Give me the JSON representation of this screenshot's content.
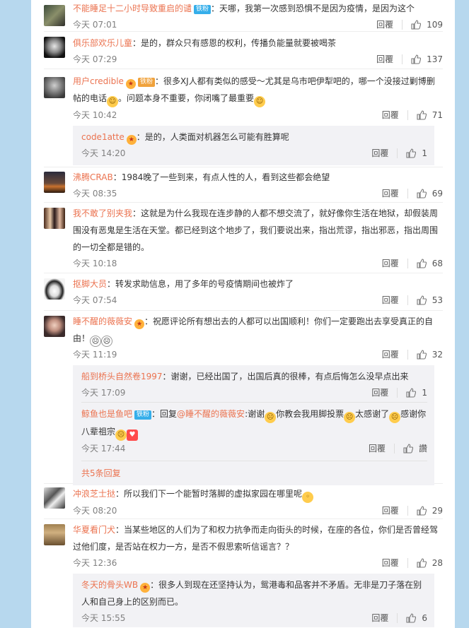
{
  "comments": [
    {
      "name": "不能睡足十二小时导致重启的谴",
      "badge": "铁粉",
      "text": "：天哪，我第一次感到恐惧不是因为疫情，是因为这个",
      "time": "今天 07:01",
      "reply": "回覆",
      "likes": "109"
    },
    {
      "name": "俱乐部欢乐儿童",
      "text": "：是的，群众只有感恩的权利，传播负能量就要被喝茶",
      "time": "今天 07:29",
      "reply": "回覆",
      "likes": "137"
    },
    {
      "name": "用户credible",
      "badge": "铁粉",
      "text_a": "：很多XJ人都有类似的感受～尤其是乌市吧伊犁吧的，哪一个没接过剿博删帖的电话",
      "text_b": "。问题本身不重要，你闭嘴了最重要",
      "time": "今天 10:42",
      "reply": "回覆",
      "likes": "71",
      "sub": [
        {
          "name": "code1atte",
          "text": "：是的，人类面对机器怎么可能有胜算呢",
          "time": "今天 14:20",
          "reply": "回覆",
          "likes": "1"
        }
      ]
    },
    {
      "name": "沸腾CRAB",
      "text": "：1984晚了一些到来，有点人性的人，看到这些都会绝望",
      "time": "今天 08:35",
      "reply": "回覆",
      "likes": "69"
    },
    {
      "name": "我不敢了别夹我",
      "text": "：这就是为什么我现在连步静的人都不想交流了，就好像你生活在地狱，却假装周围没有恶鬼是生活在天堂。都已经到这个地步了，我们要说出来，指出荒谬，指出邪恶，指出周围的一切全都是错的。",
      "time": "今天 10:18",
      "reply": "回覆",
      "likes": "68"
    },
    {
      "name": "抠脚大员",
      "text": "：转发求助信息，用了多年的号疫情期间也被炸了",
      "time": "今天 07:54",
      "reply": "回覆",
      "likes": "53"
    },
    {
      "name": "睡不醒的薇薇安",
      "text": "：祝愿评论所有想出去的人都可以出国顺利！你们一定要跑出去享受真正的自由！",
      "time": "今天 11:19",
      "reply": "回覆",
      "likes": "32",
      "sub": [
        {
          "name": "船到桥头自然卷1997",
          "text": "：谢谢，已经出国了，出国后真的很棒，有点后悔怎么没早点出来",
          "time": "今天 17:09",
          "reply": "回覆",
          "likes": "1"
        },
        {
          "name": "鲸鱼也是鱼吧",
          "badge": "铁粉",
          "text_pre": "：回复",
          "at": "@睡不醒的薇薇安",
          "text_a": ":谢谢",
          "text_b": "你教会我用脚投票",
          "text_c": "太感谢了",
          "text_d": "感谢你八辈祖宗",
          "time": "今天 17:44",
          "reply": "回覆",
          "likes": "讚"
        }
      ],
      "more": "共5条回复"
    },
    {
      "name": "冲浪芝士挞",
      "text": "：所以我们下一个能暂时落脚的虚拟家园在哪里呢",
      "time": "今天 08:20",
      "reply": "回覆",
      "likes": "29"
    },
    {
      "name": "华夏看门犬",
      "text": "：当某些地区的人们为了和权力抗争而走向街头的时候，在座的各位，你们是否曾经驾过他们度，是否站在权力一方，是否不假思索听信谣言？？",
      "time": "今天 12:36",
      "reply": "回覆",
      "likes": "28",
      "sub": [
        {
          "name": "冬天的骨头WB",
          "text": "：很多人到现在还坚持认为，鸳港毒和品客并不矛盾。无非是刀子落在别人和自己身上的区别而已。",
          "time": "今天 15:55",
          "reply": "回覆",
          "likes": "6"
        }
      ]
    }
  ],
  "colors": {
    "name": "#eb7350",
    "background": "#b7d8ee"
  }
}
